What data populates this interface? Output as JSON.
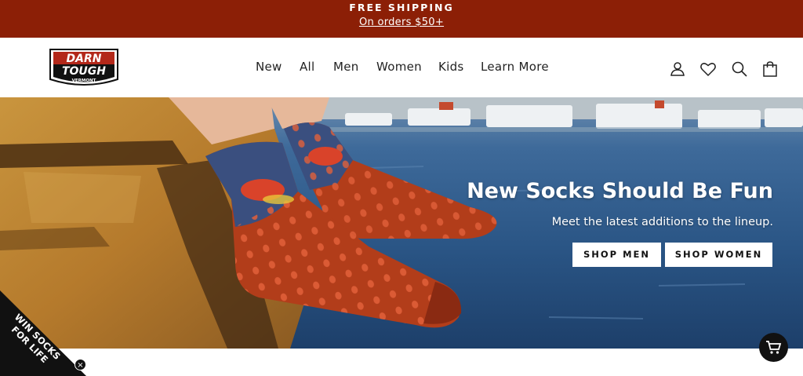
{
  "announcement": {
    "title": "FREE SHIPPING",
    "subtitle": "On orders $50+"
  },
  "brand": {
    "logo_line1": "DARN",
    "logo_line2": "TOUGH",
    "logo_line3": "VERMONT"
  },
  "nav": {
    "items": [
      {
        "label": "New"
      },
      {
        "label": "All"
      },
      {
        "label": "Men"
      },
      {
        "label": "Women"
      },
      {
        "label": "Kids"
      },
      {
        "label": "Learn More"
      }
    ]
  },
  "header_icons": [
    "account-icon",
    "heart-icon",
    "search-icon",
    "bag-icon"
  ],
  "hero": {
    "headline": "New Socks Should Be Fun",
    "subhead": "Meet the latest additions to the lineup.",
    "shop_men_label": "SHOP MEN",
    "shop_women_label": "SHOP WOMEN"
  },
  "promo_ribbon": {
    "line1": "WIN SOCKS",
    "line2": "FOR LIFE",
    "close_glyph": "×"
  },
  "colors": {
    "accent": "#8c1f06",
    "sock_orange": "#b23d1a",
    "sock_navy": "#3a4f7f",
    "water": "#2e5a8a"
  }
}
